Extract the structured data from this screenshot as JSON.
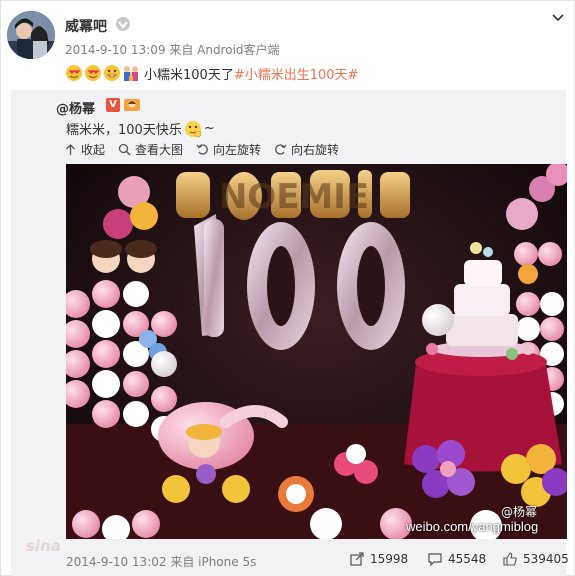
{
  "post": {
    "author": "威冪吧",
    "meta": "2014-9-10 13:09 来自 Android客户端",
    "text": "小糯米100天了",
    "topic": "#小糯米出生100天#",
    "emoji_names": [
      "heart-face-icon",
      "heart-face-icon",
      "grin-face-icon",
      "family-icon"
    ]
  },
  "repost": {
    "author": "@杨幂",
    "badge": "V",
    "text": "糯米米，100天快乐",
    "text_suffix": "~",
    "tools": {
      "collapse": "收起",
      "view_large": "查看大图",
      "rotate_left": "向左旋转",
      "rotate_right": "向右旋转"
    },
    "photo": {
      "banner": "NOEMIE",
      "number": "100",
      "watermark_name": "@杨幂",
      "watermark_url": "weibo.com/yangmiblog",
      "site_mark": "sina"
    },
    "footer_meta": "2014-9-10 13:02 来自 iPhone 5s",
    "stats": {
      "reposts": "15998",
      "comments": "45548",
      "likes": "539405"
    }
  },
  "colors": {
    "topic": "#eb7350",
    "repost_bg": "#f2f2f5",
    "meta": "#808080"
  }
}
